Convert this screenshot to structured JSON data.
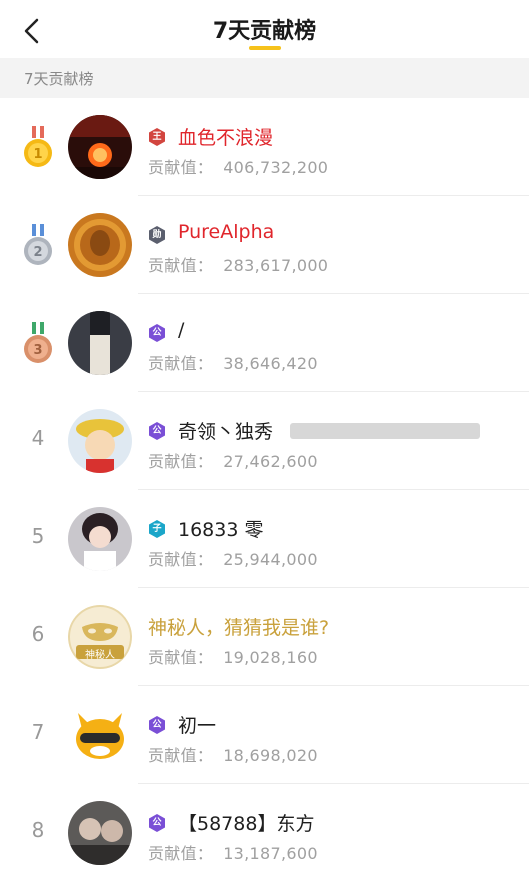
{
  "header": {
    "title": "7天贡献榜",
    "back_icon": "chevron-left-icon"
  },
  "section": {
    "label": "7天贡献榜"
  },
  "contrib_label": "贡献值：",
  "rows": [
    {
      "rank": "1",
      "badge": "王",
      "badge_color": "#d2453f",
      "name": "血色不浪漫",
      "name_color": "red",
      "value": "406,732,200"
    },
    {
      "rank": "2",
      "badge": "勋",
      "badge_color": "#5b5f6e",
      "name": "PureAlpha",
      "name_color": "red",
      "value": "283,617,000"
    },
    {
      "rank": "3",
      "badge": "公",
      "badge_color": "#7a4fd6",
      "name": "/",
      "name_color": "normal",
      "value": "38,646,420"
    },
    {
      "rank": "4",
      "badge": "公",
      "badge_color": "#7a4fd6",
      "name": "奇领丶独秀",
      "name_color": "normal",
      "value": "27,462,600"
    },
    {
      "rank": "5",
      "badge": "子",
      "badge_color": "#1ba6c9",
      "name": "16833 零",
      "name_color": "normal",
      "value": "25,944,000"
    },
    {
      "rank": "6",
      "badge": "",
      "badge_color": "",
      "name": "神秘人，猜猜我是谁?",
      "name_color": "gold",
      "value": "19,028,160",
      "avatar_label": "神秘人"
    },
    {
      "rank": "7",
      "badge": "公",
      "badge_color": "#7a4fd6",
      "name": "初一",
      "name_color": "normal",
      "value": "18,698,020"
    },
    {
      "rank": "8",
      "badge": "公",
      "badge_color": "#7a4fd6",
      "name": "【58788】东方",
      "name_color": "normal",
      "value": "13,187,600"
    }
  ]
}
